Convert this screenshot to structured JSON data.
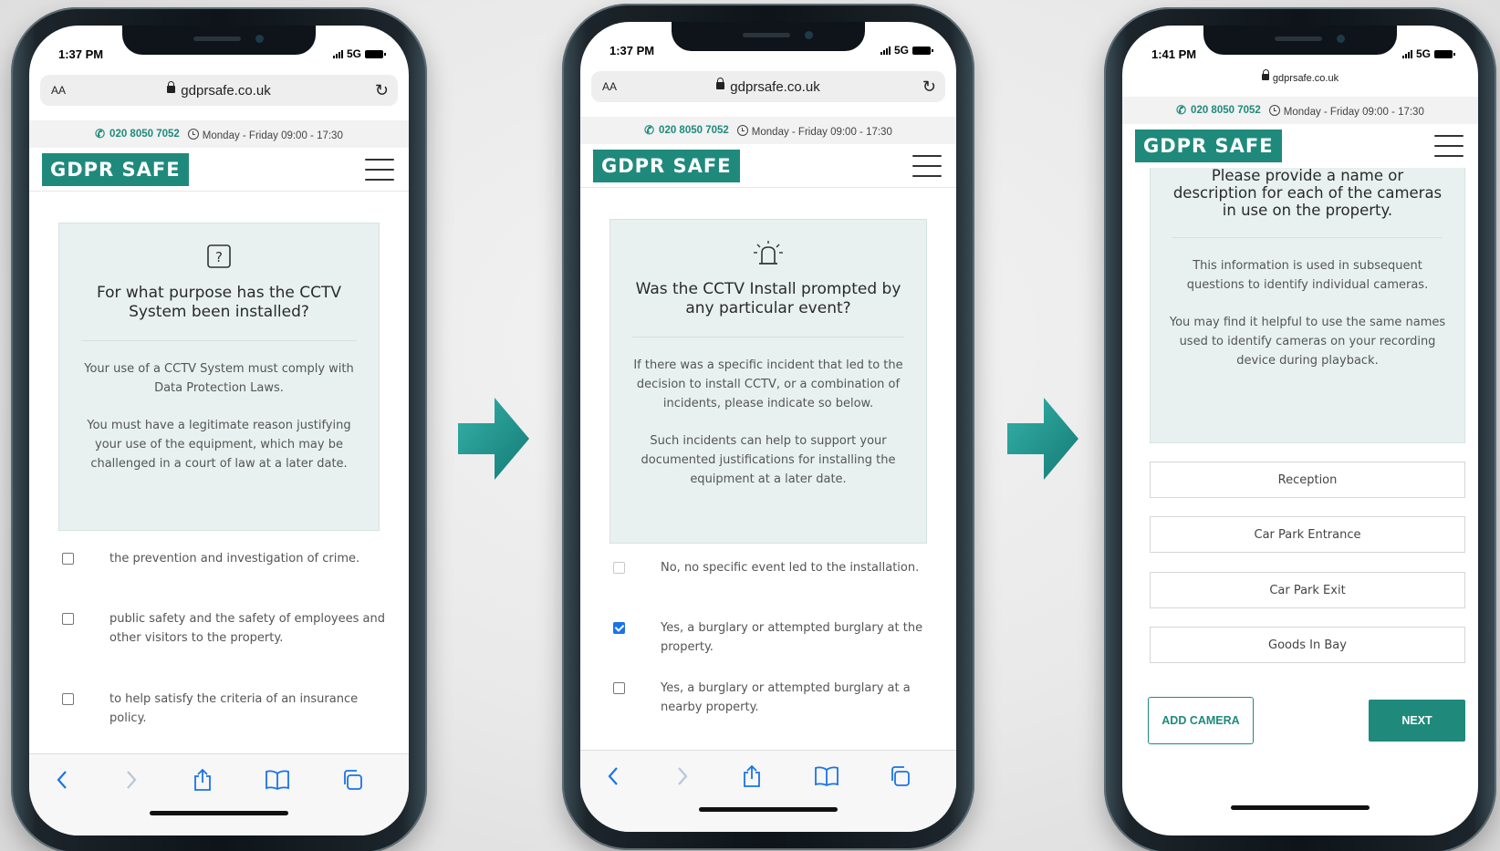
{
  "colors": {
    "brand": "#1f8a7c",
    "checkbox_checked": "#1a73e8",
    "panel_bg": "#e8f1ef"
  },
  "site": {
    "domain": "gdprsafe.co.uk",
    "aa_label": "AA",
    "phone": "020 8050 7052",
    "hours": "Monday - Friday 09:00 - 17:30",
    "logo": "GDPR SAFE"
  },
  "phones": [
    {
      "time": "1:37 PM",
      "network": "5G",
      "icon": "question-mark-icon",
      "title": "For what purpose has the CCTV System been installed?",
      "paragraphs": [
        "Your use of a CCTV System must comply with Data Protection Laws.",
        "You must have a legitimate reason justifying your use of the equipment, which may be challenged in a court of law at a later date."
      ],
      "options": [
        {
          "label": "the prevention and investigation of crime.",
          "checked": false
        },
        {
          "label": "public safety and the safety of employees and other visitors to the property.",
          "checked": false
        },
        {
          "label": "to help satisfy the criteria of an insurance policy.",
          "checked": false
        }
      ]
    },
    {
      "time": "1:37 PM",
      "network": "5G",
      "icon": "siren-icon",
      "title": "Was the CCTV Install prompted by any particular event?",
      "paragraphs": [
        "If there was a specific incident that led to the decision to install CCTV, or a combination of incidents, please indicate so below.",
        "Such incidents can help to support your documented justifications for installing the equipment at a later date."
      ],
      "options": [
        {
          "label": "No, no specific event led to the installation.",
          "checked": false,
          "disabled": true
        },
        {
          "label": "Yes, a burglary or attempted burglary at the property.",
          "checked": true
        },
        {
          "label": "Yes, a burglary or attempted burglary at a nearby property.",
          "checked": false
        }
      ]
    },
    {
      "time": "1:41 PM",
      "network": "5G",
      "title": "Please provide a name or description for each of the cameras in use on the property.",
      "paragraphs": [
        "This information is used in subsequent questions to identify individual cameras.",
        "You may find it helpful to use the same names used to identify cameras on your recording device during playback."
      ],
      "cameras": [
        "Reception",
        "Car Park Entrance",
        "Car Park Exit",
        "Goods In Bay"
      ],
      "add_button": "ADD CAMERA",
      "next_button": "NEXT"
    }
  ]
}
